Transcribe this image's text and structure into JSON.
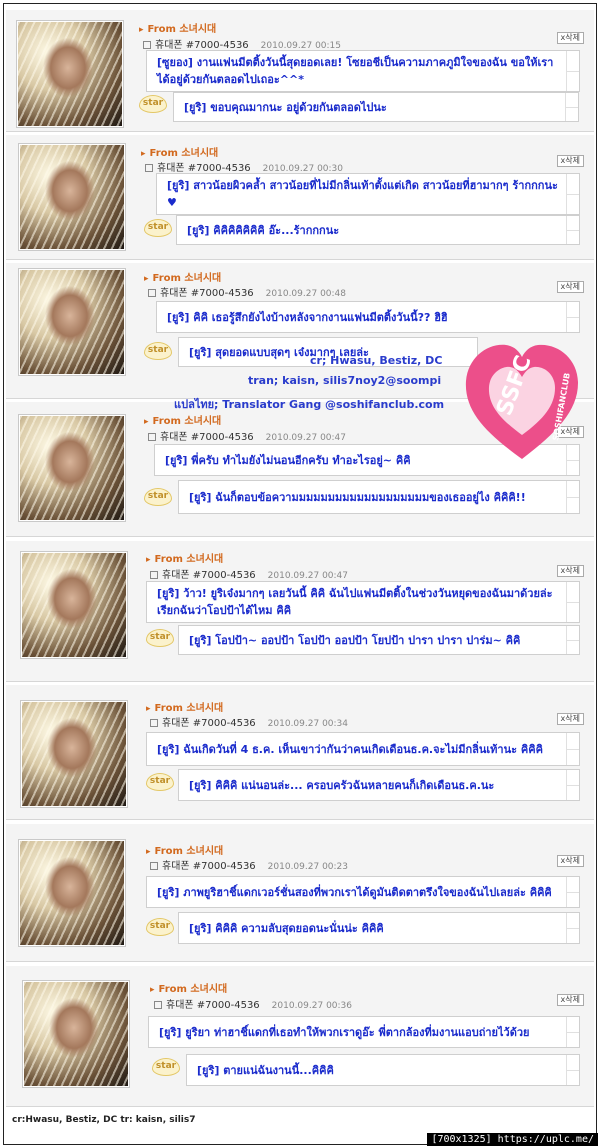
{
  "posts": [
    {
      "from": "From 소녀시대",
      "author": "휴대폰 #7000-4536",
      "date": "2010.09.27 00:15",
      "delete_label": "x삭제",
      "star_label": "star",
      "message": "[ซูยอง] งานแฟนมีตติ้งวันนี้สุดยอดเลย! โซยอชีเป็นความภาคภูมิใจของฉัน ขอให้เราได้อยู่ด้วยกันตลอดไปเถอะ^^*",
      "reply": "[ยูริ] ขอบคุณมากนะ อยู่ด้วยกันตลอดไปนะ"
    },
    {
      "from": "From 소녀시대",
      "author": "휴대폰 #7000-4536",
      "date": "2010.09.27 00:30",
      "delete_label": "x삭제",
      "star_label": "star",
      "message": "[ยูริ] สาวน้อยผิวคล้ำ สาวน้อยที่ไม่มีกลิ่นเท้าตั้งแต่เกิด สาวน้อยที่ฮามากๆ ร้ากกกนะ ♥",
      "reply": "[ยูริ] คิคิคิคิคิคิคิ อ๊ะ...ร้ากกกนะ"
    },
    {
      "from": "From 소녀시대",
      "author": "휴대폰 #7000-4536",
      "date": "2010.09.27 00:48",
      "delete_label": "x삭제",
      "star_label": "star",
      "message": "[ยูริ] คิคิ เธอรู้สึกยังไงบ้างหลังจากงานแฟนมีตติ้งวันนี้?? ฮิฮิ",
      "reply": "[ยูริ] สุดยอดแบบสุดๆ เจ๋งมากๆ เลยล่ะ"
    },
    {
      "from": "From 소녀시대",
      "author": "휴대폰 #7000-4536",
      "date": "2010.09.27 00:47",
      "delete_label": "x삭제",
      "star_label": "star",
      "message": "[ยูริ] พี่ครับ ทำไมยังไม่นอนอีกครับ ทำอะไรอยู่~ คิคิ",
      "reply": "[ยูริ] ฉันก็ตอบข้อความมมมมมมมมมมมมมมมมมมของเธออยู่ไง คิคิคิ!!"
    },
    {
      "from": "From 소녀시대",
      "author": "휴대폰 #7000-4536",
      "date": "2010.09.27 00:47",
      "delete_label": "x삭제",
      "star_label": "star",
      "message": "[ยูริ] ว้าว! ยูริเจ๋งมากๆ เลยวันนี้ คิคิ ฉันไปแฟนมีตติ้งในช่วงวันหยุดของฉันมาด้วยล่ะ เรียกฉันว่าโอปป้าได้ไหม คิคิ",
      "reply": "[ยูริ] โอปป้า~ ออปป้า โอปป้า ออปป้า โยปป้า ปารา ปารา ปาร่ม~ คิคิ"
    },
    {
      "from": "From 소녀시대",
      "author": "휴대폰 #7000-4536",
      "date": "2010.09.27 00:34",
      "delete_label": "x삭제",
      "star_label": "star",
      "message": "[ยูริ] ฉันเกิดวันที่ 4 ธ.ค. เห็นเขาว่ากันว่าคนเกิดเดือนธ.ค.จะไม่มีกลิ่นเท้านะ คิคิคิ",
      "reply": "[ยูริ] คิคิคิ แน่นอนล่ะ... ครอบครัวฉันหลายคนก็เกิดเดือนธ.ค.นะ"
    },
    {
      "from": "From 소녀시대",
      "author": "휴대폰 #7000-4536",
      "date": "2010.09.27 00:23",
      "delete_label": "x삭제",
      "star_label": "star",
      "message": "[ยูริ] ภาพยูริฮาชิ์แดกเวอร์ชั่นสองที่พวกเราได้ดูมันติดตาตรึงใจของฉันไปเลยล่ะ คิคิคิ",
      "reply": "[ยูริ] คิคิคิ ความลับสุดยอดนะนั่นน่ะ คิคิคิ"
    },
    {
      "from": "From 소녀시대",
      "author": "휴대폰 #7000-4536",
      "date": "2010.09.27 00:36",
      "delete_label": "x삭제",
      "star_label": "star",
      "message": "[ยูริ] ยูริยา ท่าฮาชิ์แดกที่เธอทำให้พวกเราดูอ๊ะ พี่ตากล้องที่มงานแอบถ่ายไว้ด้วย",
      "reply": "[ยูริ] ตายแน่ฉันงานนี้...คิคิคิ"
    }
  ],
  "overlay": {
    "credit_line1": "cr; Hwasu, Bestiz, DC",
    "credit_line2": "tran; kaisn, silis7noy2@soompi",
    "credit_line3": "แปลไทย; Translator Gang @soshifanclub.com",
    "logo_text": "SSFC",
    "logo_subtext": "SOSHIFANCLUB"
  },
  "colors": {
    "heart": "#ec4f8a",
    "message_text": "#1a2bcc",
    "from_text": "#d2691e"
  },
  "footer": {
    "credit": "cr:Hwasu, Bestiz, DC  tr: kaisn, silis7",
    "watermark": "[700x1325] https://uplc.me/"
  }
}
